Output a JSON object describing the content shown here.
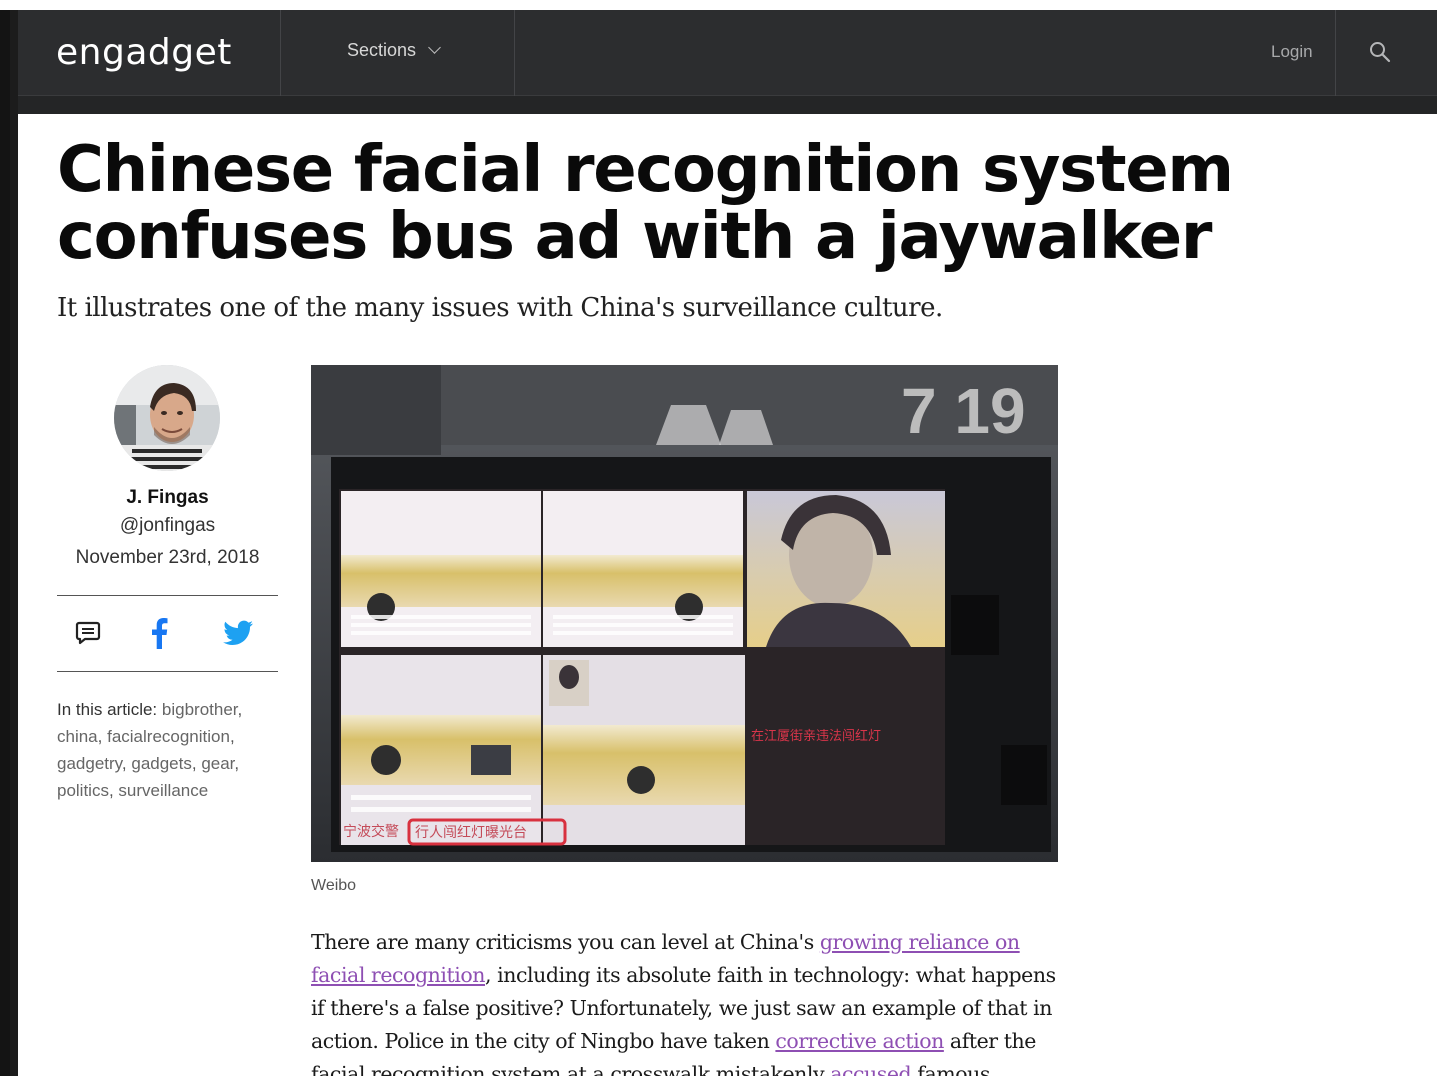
{
  "nav": {
    "logo": "engadget",
    "sections_label": "Sections",
    "login_label": "Login"
  },
  "article": {
    "headline": "Chinese facial recognition system confuses bus ad with a jaywalker",
    "subhead": "It illustrates one of the many issues with China's surveillance culture.",
    "author": {
      "name": "J. Fingas",
      "handle": "@jonfingas",
      "date": "November 23rd, 2018"
    },
    "tags_label": "In this article:",
    "tags": [
      "bigbrother",
      "china",
      "facialrecognition",
      "gadgetry",
      "gadgets",
      "gear",
      "politics",
      "surveillance"
    ],
    "image_caption": "Weibo",
    "image_overlay": {
      "clock": "7 19",
      "subtitle": "在江厦街亲违法闯红灯",
      "ticker_left": "宁波交警",
      "ticker_right": "行人闯红灯曝光台"
    },
    "body": {
      "p1_a": "There are many criticisms you can level at China's ",
      "p1_link1": "growing reliance on facial recognition",
      "p1_b": ", including its absolute faith in technology: what happens if there's a false positive? Unfortunately, we just saw an example of that in action. Police in the city of Ningbo have taken ",
      "p1_link2": "corrective action",
      "p1_c": " after the facial recognition system at a crosswalk mistakenly ",
      "p1_link3": "accused",
      "p1_d": " famous businesswoman Dong"
    }
  },
  "colors": {
    "nav_bg": "#2c2d2f",
    "link": "#8e4fb3",
    "twitter": "#1da1f2",
    "facebook": "#1877f2"
  }
}
